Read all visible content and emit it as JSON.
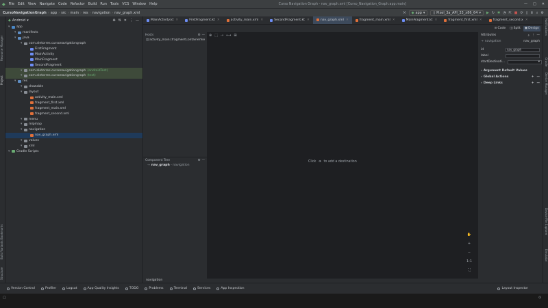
{
  "titlebar": {
    "menus": [
      "File",
      "Edit",
      "View",
      "Navigate",
      "Code",
      "Refactor",
      "Build",
      "Run",
      "Tools",
      "VCS",
      "Window",
      "Help"
    ],
    "title": "Curso Navigation Graph - nav_graph.xml [Curso_Navigation_Graph.app.main]"
  },
  "navbar": {
    "breadcrumbs": [
      "CursoNavigationGraph",
      "app",
      "src",
      "main",
      "res",
      "navigation",
      "nav_graph.xml"
    ],
    "run_config": "app",
    "device": "Pixel_3a_API_33_x86_64"
  },
  "project": {
    "view": "Android",
    "tree": [
      {
        "label": "app",
        "indent": 0,
        "icon": "folder",
        "color": "#4a88c7"
      },
      {
        "label": "manifests",
        "indent": 1,
        "icon": "folder",
        "color": "#5f8ec4"
      },
      {
        "label": "java",
        "indent": 1,
        "icon": "folder",
        "color": "#5f8ec4"
      },
      {
        "label": "com.aletorres.cursonavigationgraph",
        "indent": 2,
        "icon": "package",
        "color": "#8a8f96"
      },
      {
        "label": "FirstFragment",
        "indent": 3,
        "icon": "kotlin",
        "color": "#6e8ef5"
      },
      {
        "label": "MainActivity",
        "indent": 3,
        "icon": "kotlin",
        "color": "#6e8ef5"
      },
      {
        "label": "MainFragment",
        "indent": 3,
        "icon": "kotlin",
        "color": "#6e8ef5"
      },
      {
        "label": "SecondFragment",
        "indent": 3,
        "icon": "kotlin",
        "color": "#6e8ef5"
      },
      {
        "label": "com.aletorres.cursonavigationgraph",
        "suffix": "(androidTest)",
        "indent": 2,
        "icon": "package",
        "color": "#8a8f96",
        "hl": true
      },
      {
        "label": "com.aletorres.cursonavigationgraph",
        "suffix": "(test)",
        "indent": 2,
        "icon": "package",
        "color": "#8a8f96",
        "hl": true
      },
      {
        "label": "res",
        "indent": 1,
        "icon": "folder",
        "color": "#5f8ec4"
      },
      {
        "label": "drawable",
        "indent": 2,
        "icon": "folder",
        "color": "#8a8f96"
      },
      {
        "label": "layout",
        "indent": 2,
        "icon": "folder",
        "color": "#8a8f96"
      },
      {
        "label": "activity_main.xml",
        "indent": 3,
        "icon": "xml",
        "color": "#e0703a"
      },
      {
        "label": "fragment_first.xml",
        "indent": 3,
        "icon": "xml",
        "color": "#e0703a"
      },
      {
        "label": "fragment_main.xml",
        "indent": 3,
        "icon": "xml",
        "color": "#e0703a"
      },
      {
        "label": "fragment_second.xml",
        "indent": 3,
        "icon": "xml",
        "color": "#e0703a"
      },
      {
        "label": "menu",
        "indent": 2,
        "icon": "folder",
        "color": "#8a8f96"
      },
      {
        "label": "mipmap",
        "indent": 2,
        "icon": "folder",
        "color": "#8a8f96"
      },
      {
        "label": "navigation",
        "indent": 2,
        "icon": "folder",
        "color": "#8a8f96"
      },
      {
        "label": "nav_graph.xml",
        "indent": 3,
        "icon": "xml",
        "color": "#e0703a",
        "sel": true
      },
      {
        "label": "values",
        "indent": 2,
        "icon": "folder",
        "color": "#8a8f96"
      },
      {
        "label": "xml",
        "indent": 2,
        "icon": "folder",
        "color": "#8a8f96"
      },
      {
        "label": "Gradle Scripts",
        "indent": 0,
        "icon": "gradle",
        "color": "#6aab73"
      }
    ]
  },
  "tabs": [
    {
      "label": "MainActivity.kt",
      "color": "#6e8ef5"
    },
    {
      "label": "FirstFragment.kt",
      "color": "#6e8ef5"
    },
    {
      "label": "activity_main.xml",
      "color": "#e0703a"
    },
    {
      "label": "SecondFragment.kt",
      "color": "#6e8ef5"
    },
    {
      "label": "nav_graph.xml",
      "color": "#e0703a",
      "active": true
    },
    {
      "label": "fragment_main.xml",
      "color": "#e0703a"
    },
    {
      "label": "MainFragment.kt",
      "color": "#6e8ef5"
    },
    {
      "label": "fragment_first.xml",
      "color": "#e0703a"
    },
    {
      "label": "fragment_second.x",
      "color": "#e0703a"
    }
  ],
  "view_modes": {
    "code": "Code",
    "split": "Split",
    "design": "Design"
  },
  "hosts": {
    "title": "Hosts",
    "item": "activity_main (fragmentContainerVie"
  },
  "component_tree": {
    "title": "Component Tree",
    "item_name": "nav_graph",
    "item_type": " - navigation"
  },
  "canvas": {
    "hint_pre": "Click",
    "hint_post": "to add a destination"
  },
  "bottom_path": "navigation",
  "attributes": {
    "title": "Attributes",
    "type": "navigation",
    "name": "nav_graph",
    "fields": [
      {
        "label": "id",
        "value": "nav_graph"
      },
      {
        "label": "label",
        "value": ""
      },
      {
        "label": "startDestinati...",
        "value": ""
      }
    ],
    "sections": [
      "Argument Default Values",
      "Global Actions",
      "Deep Links"
    ]
  },
  "leftstrip": {
    "top": [
      "Resource Manager",
      "Project"
    ],
    "bottom": [
      "Bookmarks",
      "Build Variants",
      "Structure"
    ]
  },
  "rightstrip": {
    "top": [
      "Notifications",
      "Gradle",
      "Device Manager"
    ],
    "bottom": [
      "Device File Explorer",
      "Emulator"
    ]
  },
  "statusbar": {
    "items": [
      "Version Control",
      "Profiler",
      "Logcat",
      "App Quality Insights",
      "TODO",
      "Problems",
      "Terminal",
      "Services",
      "App Inspection"
    ],
    "right": "Layout Inspector"
  }
}
